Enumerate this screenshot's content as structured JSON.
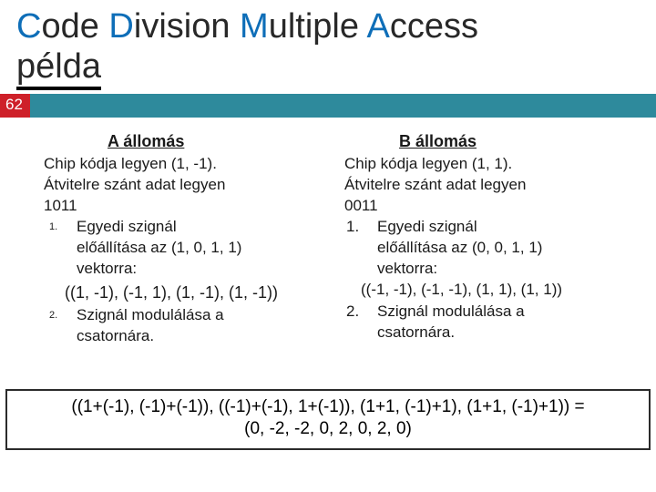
{
  "title": {
    "w1_initial": "C",
    "w1_rest": "ode",
    "w2_initial": "D",
    "w2_rest": "ivision",
    "w3_initial": "M",
    "w3_rest": "ultiple",
    "w4_initial": "A",
    "w4_rest": "ccess",
    "line2": "példa"
  },
  "page_number": "62",
  "stationA": {
    "heading": "A állomás",
    "chip": "Chip kódja legyen (1, -1).",
    "data_label": "Átvitelre szánt adat legyen",
    "data_bits": "1011",
    "item1_a": "Egyedi szignál",
    "item1_b": "előállítása az (1, 0, 1, 1)",
    "item1_c": "vektorra:",
    "signal": "((1, -1), (-1, 1), (1, -1), (1, -1))",
    "item2_a": "Szignál modulálása a",
    "item2_b": "csatornára."
  },
  "stationB": {
    "heading": "B állomás",
    "chip": "Chip kódja legyen (1, 1).",
    "data_label": "Átvitelre szánt adat legyen",
    "data_bits": "0011",
    "item1_a": "Egyedi szignál",
    "item1_b": "előállítása az (0, 0, 1, 1)",
    "item1_c": "vektorra:",
    "signal": "((-1, -1), (-1, -1), (1, 1), (1, 1))",
    "item2_a": "Szignál modulálása a",
    "item2_b": "csatornára."
  },
  "calc": {
    "line1": "((1+(-1), (-1)+(-1)), ((-1)+(-1), 1+(-1)), (1+1, (-1)+1), (1+1, (-1)+1)) =",
    "line2": "(0, -2, -2, 0, 2, 0, 2, 0)"
  },
  "list_markers": {
    "one": "1.",
    "two": "2."
  }
}
